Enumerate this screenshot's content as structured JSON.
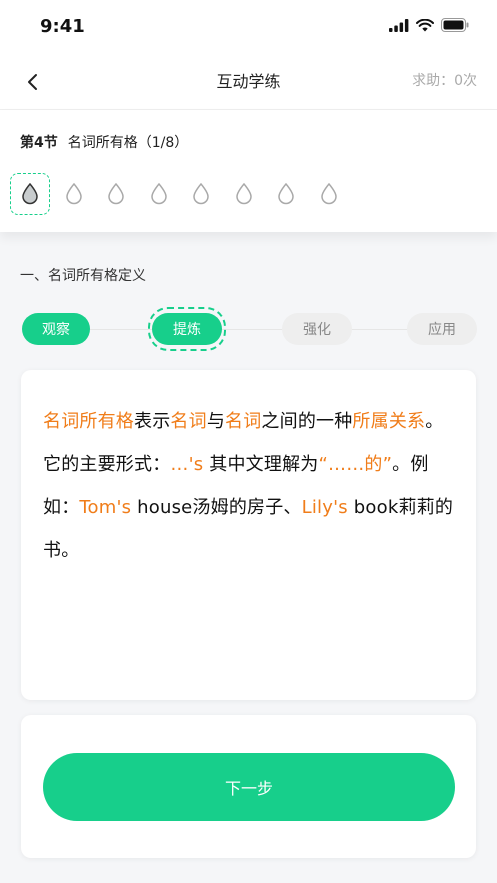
{
  "status_bar": {
    "time": "9:41"
  },
  "nav": {
    "title": "互动学练",
    "help": "求助：0次"
  },
  "lesson": {
    "section_number": "第4节",
    "section_name": "名词所有格（1/8）",
    "total_drops": 8,
    "current_drop": 1
  },
  "definition_title": "一、名词所有格定义",
  "steps": [
    {
      "label": "观察",
      "status": "done"
    },
    {
      "label": "提炼",
      "status": "current"
    },
    {
      "label": "强化",
      "status": "todo"
    },
    {
      "label": "应用",
      "status": "todo"
    }
  ],
  "content": [
    {
      "text": "名词所有格",
      "highlight": true
    },
    {
      "text": "表示",
      "highlight": false
    },
    {
      "text": "名词",
      "highlight": true
    },
    {
      "text": "与",
      "highlight": false
    },
    {
      "text": "名词",
      "highlight": true
    },
    {
      "text": "之间的一种",
      "highlight": false
    },
    {
      "text": "所属关系",
      "highlight": true
    },
    {
      "text": "。它的主要形式：",
      "highlight": false
    },
    {
      "text": "…'s",
      "highlight": true
    },
    {
      "text": " 其中文理解为",
      "highlight": false
    },
    {
      "text": "“……的”",
      "highlight": true
    },
    {
      "text": "。例如：",
      "highlight": false
    },
    {
      "text": "Tom's",
      "highlight": true
    },
    {
      "text": " house汤姆的房子、",
      "highlight": false
    },
    {
      "text": "Lily's",
      "highlight": true
    },
    {
      "text": " book莉莉的书。",
      "highlight": false
    }
  ],
  "next_button": "下一步",
  "colors": {
    "accent": "#17cf8b",
    "highlight": "#f07d1a"
  }
}
